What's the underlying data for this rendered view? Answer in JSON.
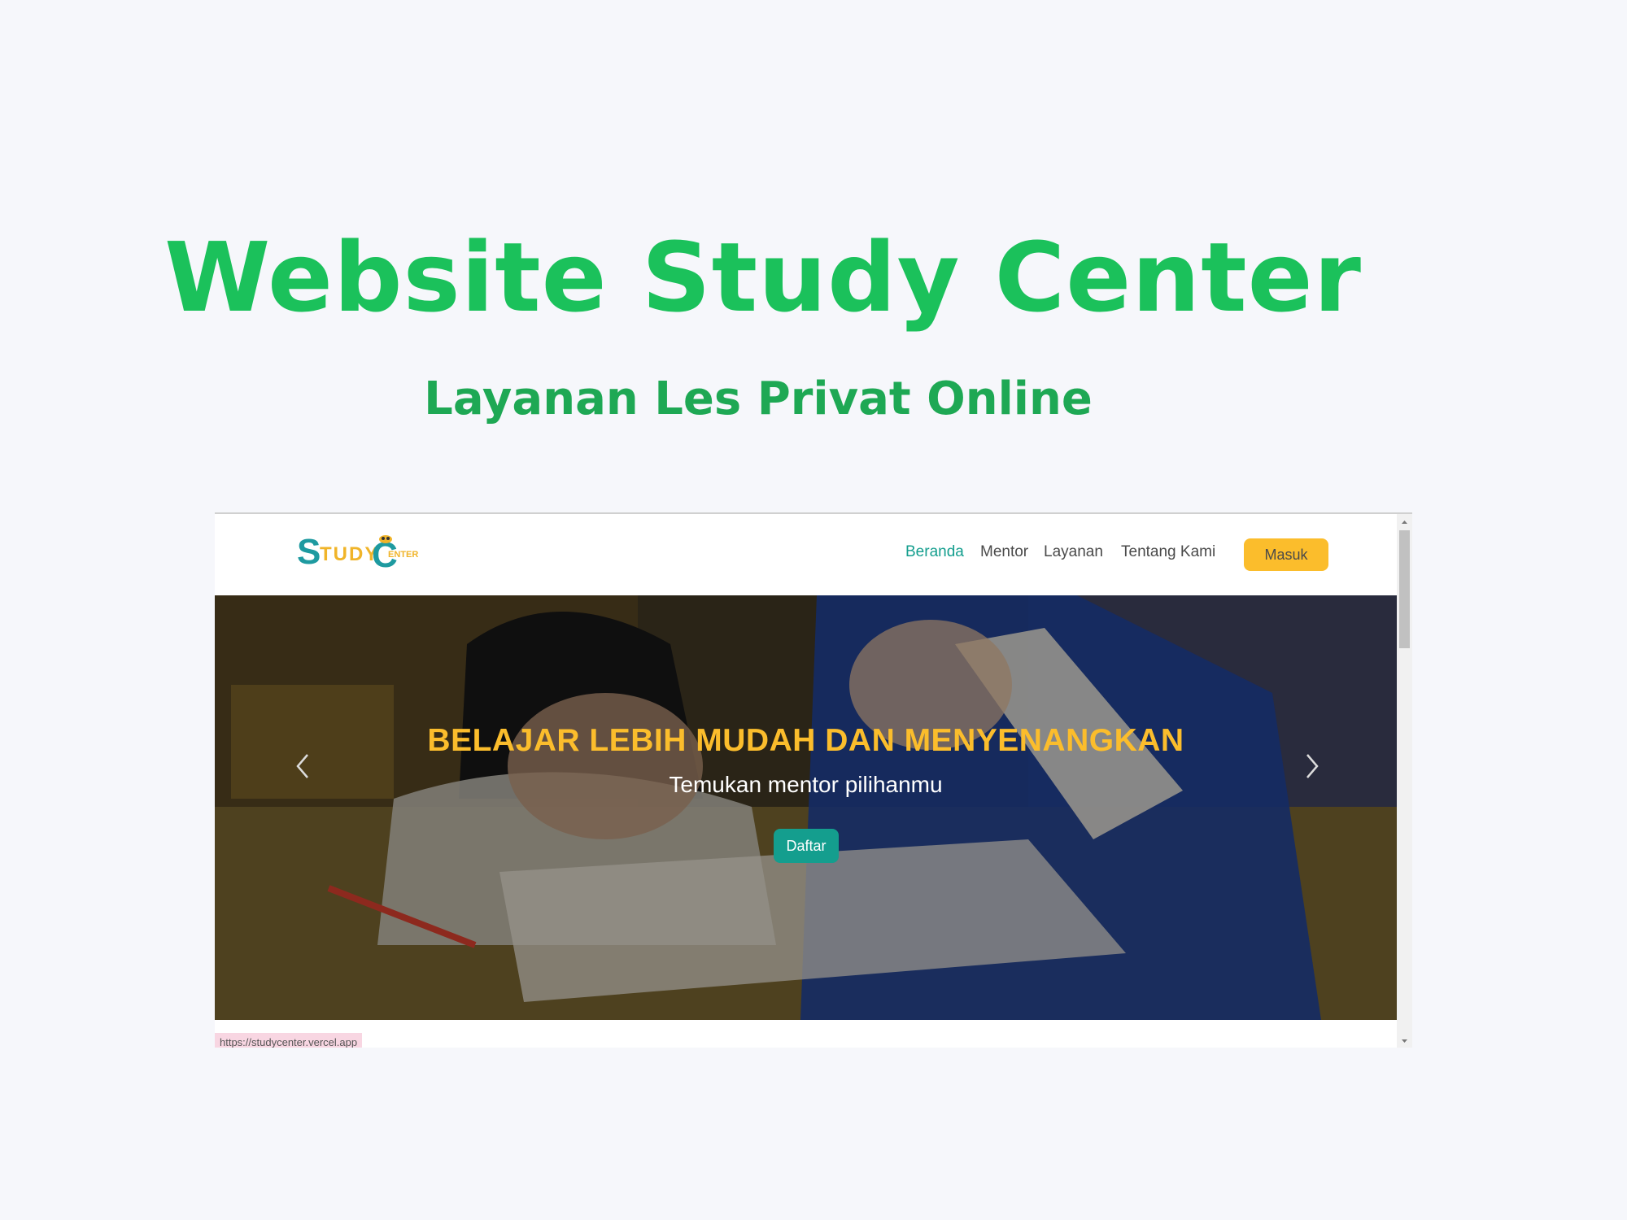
{
  "promo": {
    "title": "Website Study Center",
    "subtitle": "Layanan Les Privat Online",
    "title_color": "#1bc15b",
    "subtitle_color": "#1ea854"
  },
  "site": {
    "logo": {
      "s": "S",
      "tudy": "TUDY",
      "c": "C",
      "enter": "ENTER"
    },
    "nav": [
      {
        "label": "Beranda",
        "active": true
      },
      {
        "label": "Mentor",
        "active": false
      },
      {
        "label": "Layanan",
        "active": false
      },
      {
        "label": "Tentang Kami",
        "active": false
      }
    ],
    "login_label": "Masuk",
    "hero": {
      "title": "BELAJAR LEBIH MUDAH DAN MENYENANGKAN",
      "subtitle": "Temukan mentor pilihanmu",
      "cta_label": "Daftar"
    },
    "colors": {
      "primary": "#149e8e",
      "accent": "#fbbd2c"
    }
  },
  "browser": {
    "status_url": "https://studycenter.vercel.app"
  },
  "icons": {
    "prev": "chevron-left-icon",
    "next": "chevron-right-icon",
    "scroll_up": "triangle-up-icon",
    "scroll_down": "triangle-down-icon"
  }
}
